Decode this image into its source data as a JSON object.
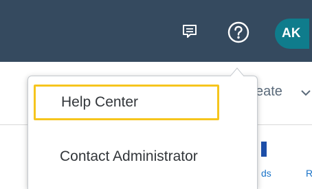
{
  "shell_bar": {
    "feedback_icon": "feedback-icon",
    "help_icon": "help-icon",
    "avatar_initials": "AK",
    "background_color": "#354a5f",
    "avatar_color": "#0f7c8c"
  },
  "page": {
    "create_label": "eate",
    "tile_label_a": "ds",
    "tile_label_b": "R"
  },
  "help_menu": {
    "items": [
      {
        "label": "Help Center",
        "highlighted": true
      },
      {
        "label": "Contact Administrator",
        "highlighted": false
      }
    ],
    "highlight_color": "#f6c51d"
  }
}
